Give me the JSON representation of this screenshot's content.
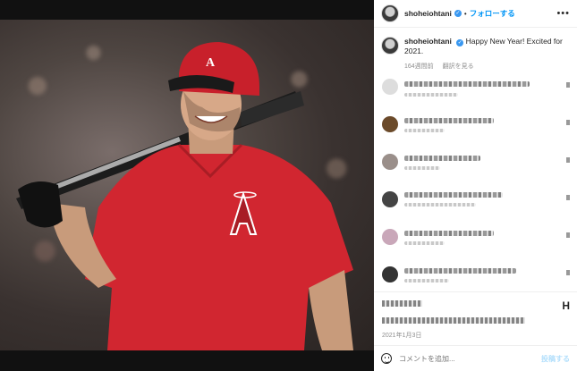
{
  "header": {
    "username": "shoheiohtani",
    "follow_label": "フォローする",
    "separator": "•",
    "more_label": "•••"
  },
  "caption": {
    "username": "shoheiohtani",
    "text": "Happy New Year! Excited for 2021.",
    "time_ago": "164週間前",
    "translate_label": "翻訳を見る"
  },
  "comments_blurred": true,
  "actions": {
    "bookmark_glyph": "H",
    "date": "2021年1月3日"
  },
  "comment_box": {
    "placeholder": "コメントを追加...",
    "post_label": "投稿する"
  },
  "colors": {
    "accent": "#0095f6",
    "verified": "#3897f0",
    "jersey_red": "#d12630"
  },
  "icons": [
    "verified-badge-icon",
    "more-options-icon",
    "bookmark-icon",
    "emoji-icon"
  ]
}
